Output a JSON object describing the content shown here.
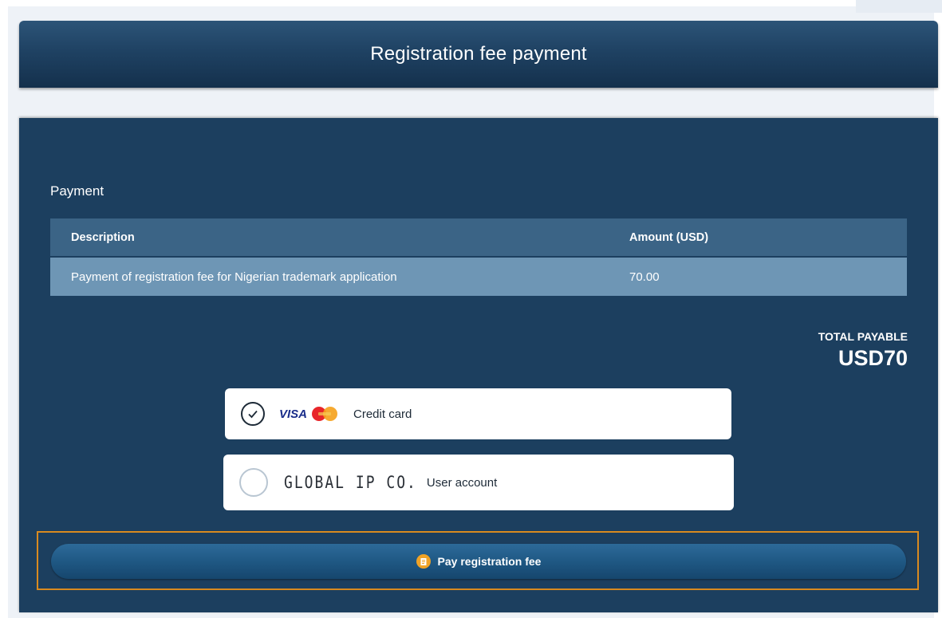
{
  "header": {
    "title": "Registration fee payment"
  },
  "payment": {
    "section_title": "Payment",
    "columns": [
      "Description",
      "Amount (USD)"
    ],
    "rows": [
      {
        "description": "Payment of registration fee for Nigerian trademark application",
        "amount": "70.00"
      }
    ],
    "total_label": "TOTAL PAYABLE",
    "total_value": "USD70"
  },
  "options": [
    {
      "brand": "VISA",
      "label": "Credit card",
      "selected": true
    },
    {
      "brand": "GLOBAL IP CO.",
      "label": "User account",
      "selected": false
    }
  ],
  "pay_button": {
    "label": "Pay registration fee"
  },
  "colors": {
    "panel": "#1c3f5f",
    "table_header": "#3b6486",
    "table_row": "#6e96b5",
    "accent_border": "#d98a1f"
  }
}
